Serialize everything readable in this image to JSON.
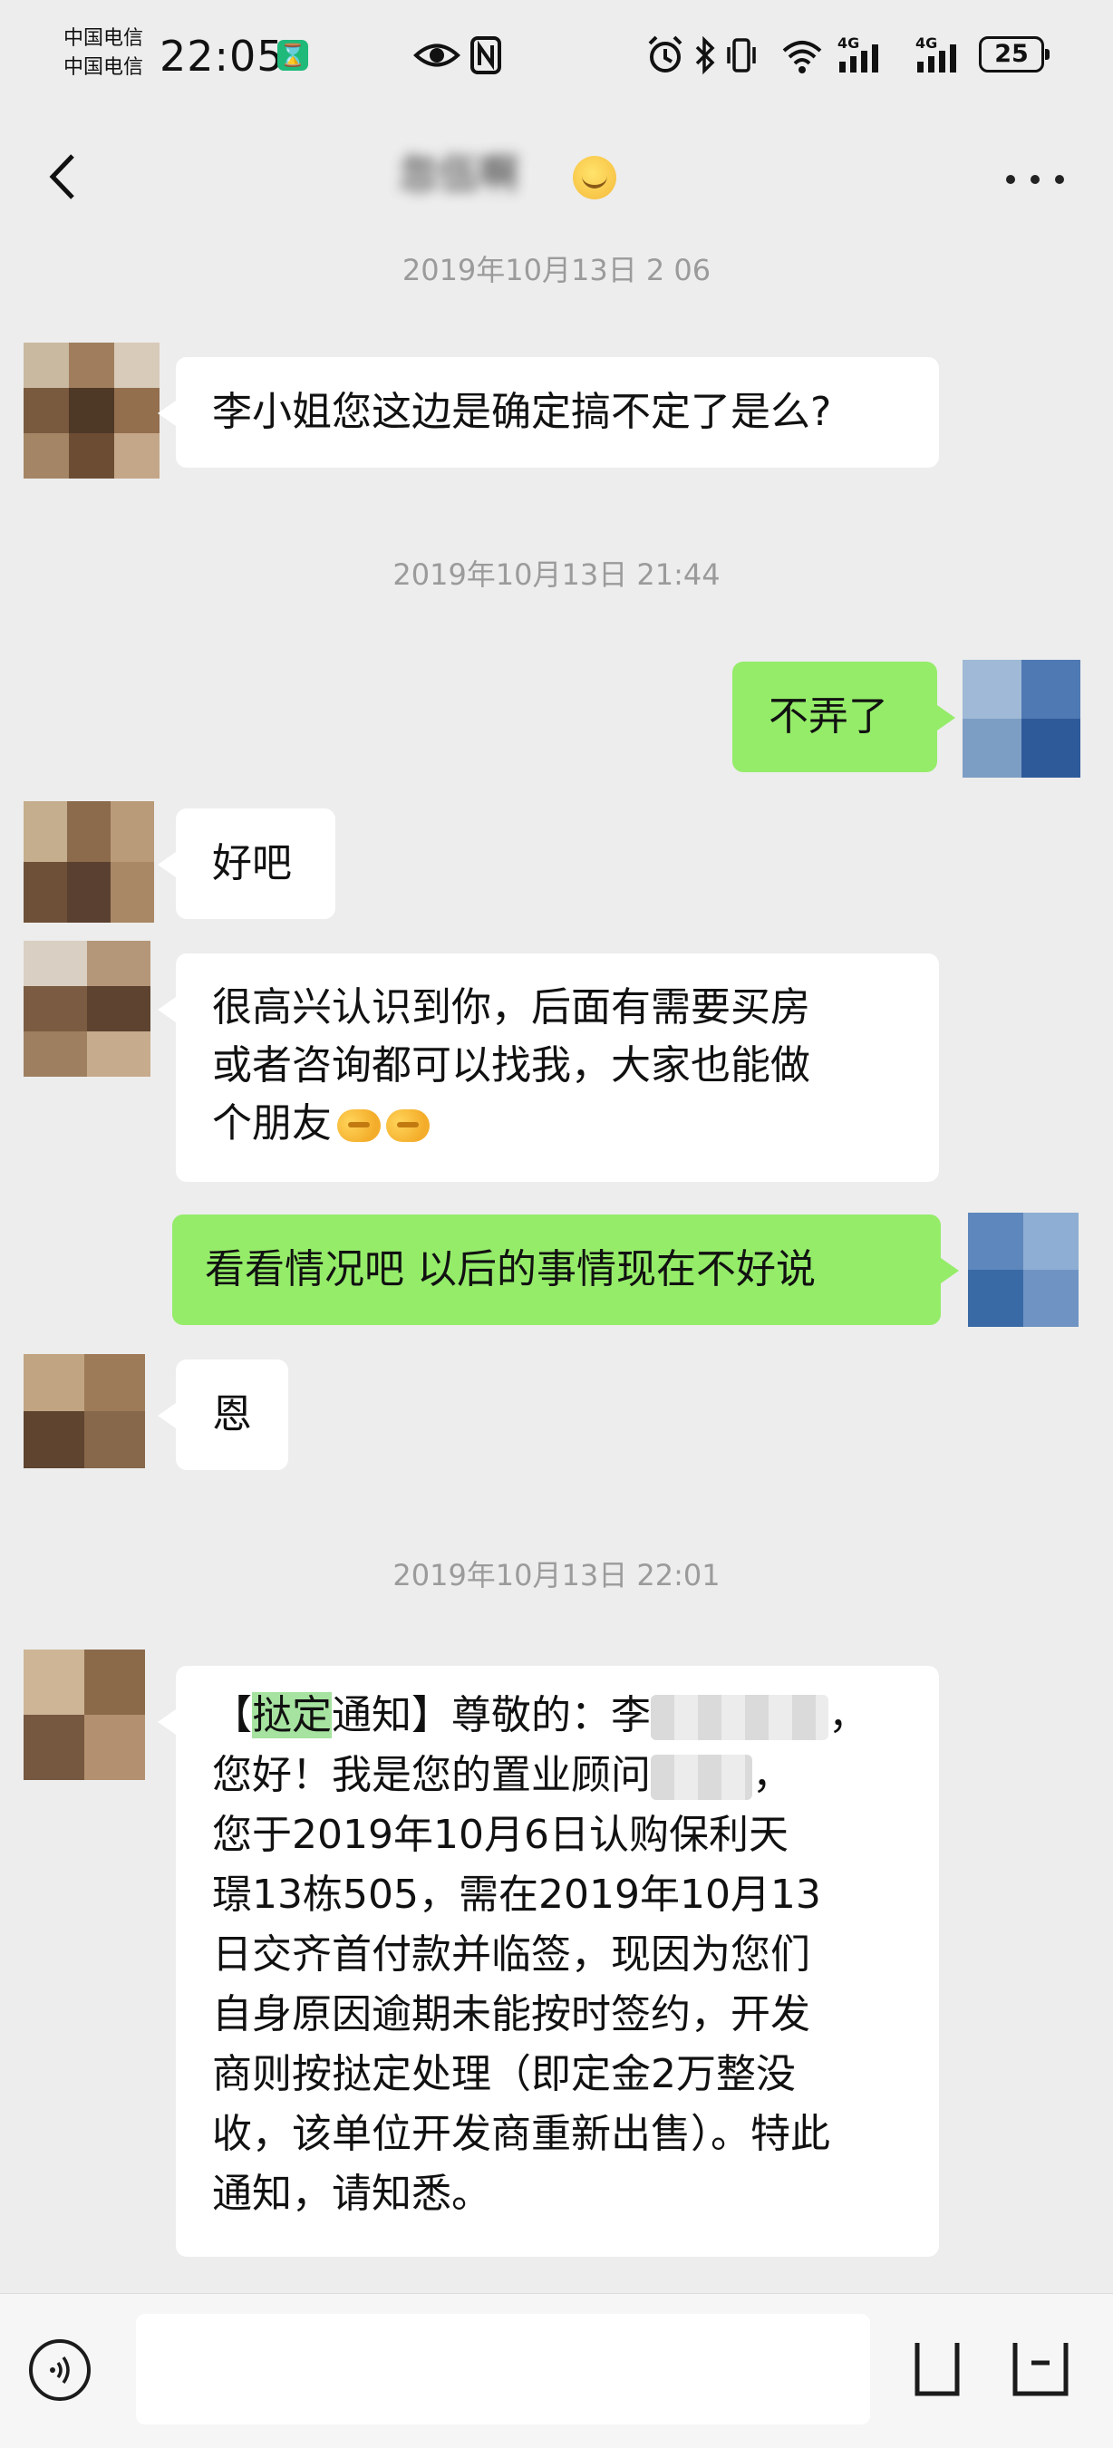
{
  "status_bar": {
    "carrier_1": "中国电信",
    "carrier_2": "中国电信",
    "time": "22:05",
    "network_1": "4G",
    "network_2": "4G",
    "battery": "25"
  },
  "header": {
    "title": "忽伍啊",
    "back_icon": "chevron-left-icon",
    "more_icon": "more-dots-icon"
  },
  "messages": [
    {
      "type": "timestamp",
      "text": "2019年10月13日 2  06"
    },
    {
      "type": "incoming",
      "text": "李小姐您这边是确定搞不定了是么?"
    },
    {
      "type": "timestamp",
      "text": "2019年10月13日 21:44"
    },
    {
      "type": "outgoing",
      "text": "不弄了"
    },
    {
      "type": "incoming",
      "text": "好吧"
    },
    {
      "type": "incoming",
      "line1": "很高兴认识到你，后面有需要买房",
      "line2": "或者咨询都可以找我，大家也能做",
      "line3": "个朋友"
    },
    {
      "type": "outgoing",
      "text": "看看情况吧 以后的事情现在不好说"
    },
    {
      "type": "incoming",
      "text": "恩"
    },
    {
      "type": "timestamp",
      "text": "2019年10月13日 22:01"
    },
    {
      "type": "incoming",
      "highlight": "挞定",
      "lines": [
        "【",
        "通知】尊敬的：李",
        "，",
        "您好！我是您的置业顾问",
        "，",
        "您于2019年10月6日认购保利天",
        "璟13栋505，需在2019年10月13",
        "日交齐首付款并临签，现因为您们",
        "自身原因逾期未能按时签约，开发",
        "商则按挞定处理（即定金2万整没",
        "收，该单位开发商重新出售）。特此",
        "通知，请知悉。"
      ]
    }
  ],
  "input_bar": {
    "input_value": "",
    "voice_icon": "voice-icon",
    "emoji_icon": "emoji-icon",
    "plus_icon": "plus-icon"
  }
}
